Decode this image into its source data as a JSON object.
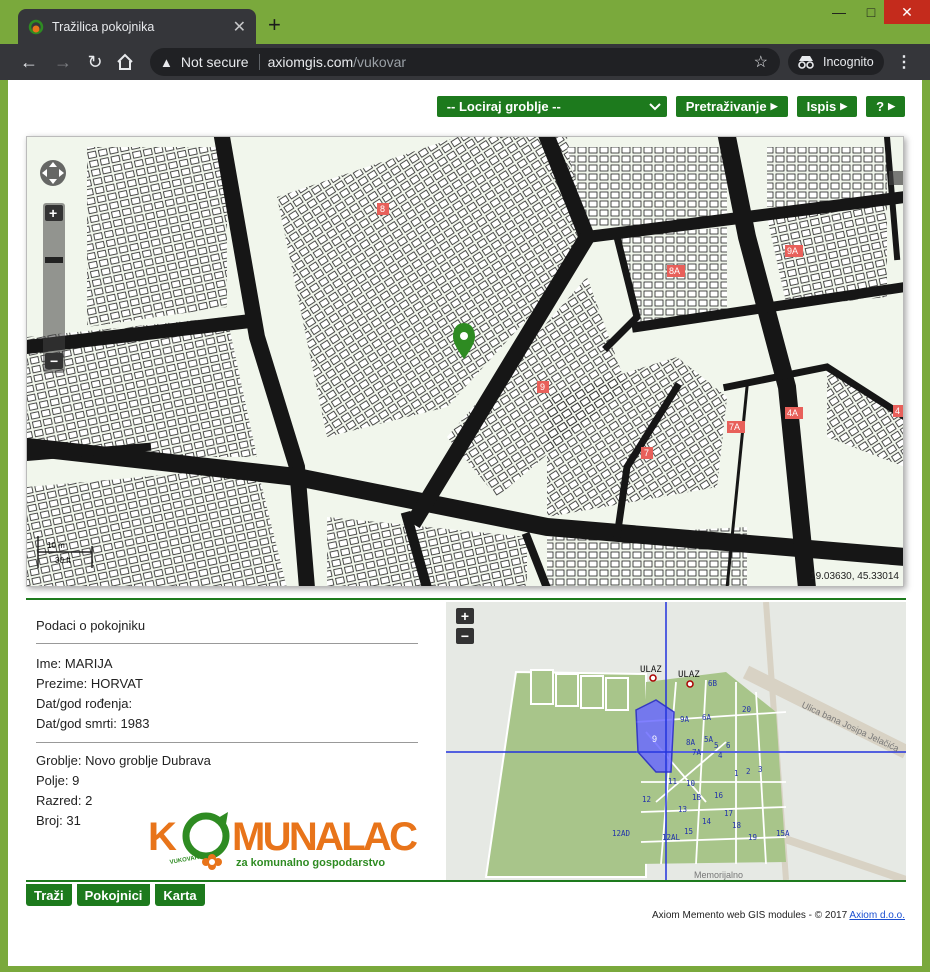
{
  "browser": {
    "tab_title": "Tražilica pokojnika",
    "tab_close": "✕",
    "new_tab": "+",
    "security_label": "Not secure",
    "url_host": "axiomgis.com",
    "url_path": "/vukovar",
    "incognito_label": "Incognito",
    "win_min": "—",
    "win_max": "□",
    "win_close": "✕"
  },
  "toolbar": {
    "locate_label": "-- Lociraj groblje --",
    "search_label": "Pretraživanje",
    "print_label": "Ispis",
    "help_label": "?"
  },
  "map": {
    "coordinates": "19.03630, 45.33014",
    "scale_top": "10 m",
    "scale_bottom": "30 ft",
    "field_labels": [
      "8",
      "8A",
      "9",
      "9A",
      "7",
      "7A",
      "4A",
      "4"
    ]
  },
  "deceased": {
    "section_title": "Podaci o pokojniku",
    "first_name": "Ime: MARIJA",
    "last_name": "Prezime: HORVAT",
    "birth": "Dat/god rođenja:",
    "death": "Dat/god smrti: 1983",
    "cemetery": "Groblje: Novo groblje Dubrava",
    "field": "Polje: 9",
    "row": "Razred: 2",
    "number": "Broj: 31"
  },
  "logo": {
    "letter_k": "K",
    "word": "MUNALAC",
    "subtitle": "za komunalno gospodarstvo",
    "side_text": "VUKOVAR"
  },
  "minimap": {
    "entrance_label": "ULAZ",
    "street_label": "Ulica bana Josipa Jelačića",
    "memorial_label": "Memorijalno",
    "selected_field": "9",
    "fields": [
      "6B",
      "6A",
      "5A",
      "5",
      "6",
      "9A",
      "8A",
      "7A",
      "4",
      "3",
      "2",
      "1",
      "1B",
      "16",
      "17",
      "18",
      "19",
      "15",
      "14",
      "13",
      "12",
      "11",
      "10",
      "12AD",
      "12AL",
      "15A",
      "20"
    ]
  },
  "bottom_tabs": {
    "search": "Traži",
    "deceased": "Pokojnici",
    "map": "Karta"
  },
  "footer": {
    "text": "Axiom Memento web GIS modules - © 2017",
    "link": "Axiom d.o.o."
  },
  "colors": {
    "accent_green": "#1d7a1d",
    "marker_green": "#2e8b22",
    "field_label_red": "#e8605a"
  }
}
